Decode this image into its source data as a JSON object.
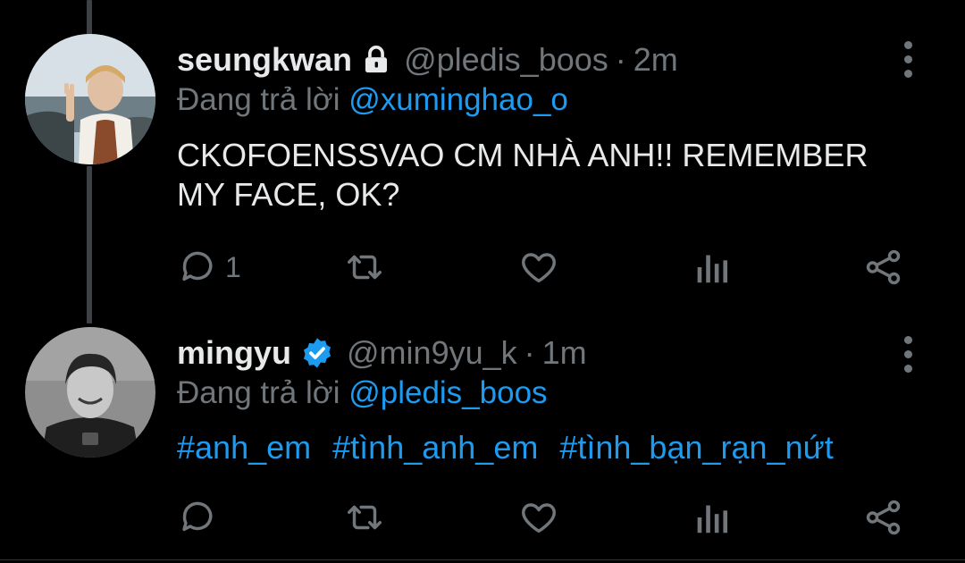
{
  "tweets": [
    {
      "display_name": "seungkwan",
      "badge": "lock-icon",
      "handle": "@pledis_boos",
      "separator": "·",
      "time": "2m",
      "reply_prefix": "Đang trả lời",
      "reply_to": "@xuminghao_o",
      "text": "CKOFOENSSVAO CM NHÀ ANH!! REMEMBER MY FACE, OK?",
      "reply_count": "1"
    },
    {
      "display_name": "mingyu",
      "badge": "verified-icon",
      "handle": "@min9yu_k",
      "separator": "·",
      "time": "1m",
      "reply_prefix": "Đang trả lời",
      "reply_to": "@pledis_boos",
      "hashtags": [
        "#anh_em",
        "#tình_anh_em",
        "#tình_bạn_rạn_nứt"
      ]
    }
  ],
  "colors": {
    "background": "#000000",
    "text": "#e7e9ea",
    "muted": "#71767b",
    "accent": "#1d9bf0",
    "thread_line": "#3d4145"
  }
}
